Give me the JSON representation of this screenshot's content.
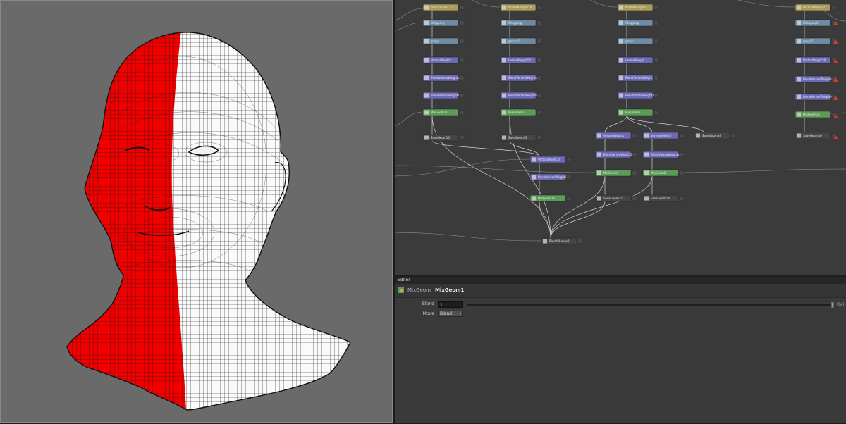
{
  "viewport": {
    "colors": {
      "background": "#6a6a6a",
      "mesh_base": "#fafafa",
      "mesh_selected": "#f20000",
      "wire": "#1a1a1a"
    }
  },
  "node_graph": {
    "colors": {
      "background": "#3b3b3b",
      "cache": "#a99b5b",
      "wrap": "#6f8aa3",
      "group": "#6f8aa3",
      "vertex": "#6c6ab8",
      "mesh": "#5d9c58",
      "output": "#464646",
      "wire": "#cfd3d6"
    },
    "nodes": [
      {
        "id": "n1",
        "label": "bscmDGrap127",
        "kind": "cache"
      },
      {
        "id": "n2",
        "label": "Wrapping",
        "kind": "wrap"
      },
      {
        "id": "n3",
        "label": "group",
        "kind": "group"
      },
      {
        "id": "n4",
        "label": "VertexWeight1",
        "kind": "vertex"
      },
      {
        "id": "n5",
        "label": "BlendVertexWeights2",
        "kind": "vertex"
      },
      {
        "id": "n6",
        "label": "BlendVertexWeight1",
        "kind": "vertex"
      },
      {
        "id": "n7",
        "label": "MixGeom11",
        "kind": "mesh"
      },
      {
        "id": "n8",
        "label": "SaveGeom16",
        "kind": "output"
      },
      {
        "id": "n9",
        "label": "bscmDGraphs10",
        "kind": "cache"
      },
      {
        "id": "n10",
        "label": "Wrapping",
        "kind": "wrap"
      },
      {
        "id": "n11",
        "label": "group10",
        "kind": "group"
      },
      {
        "id": "n12",
        "label": "VertexWeight10",
        "kind": "vertex"
      },
      {
        "id": "n13",
        "label": "BlendVertexWeights11",
        "kind": "vertex"
      },
      {
        "id": "n14",
        "label": "BlendVertexWeights12",
        "kind": "vertex"
      },
      {
        "id": "n15",
        "label": "MixGeom13",
        "kind": "mesh"
      },
      {
        "id": "n16",
        "label": "SaveGeom18",
        "kind": "output"
      },
      {
        "id": "n17",
        "label": "bscmDGraph8",
        "kind": "cache"
      },
      {
        "id": "n18",
        "label": "Wrapping",
        "kind": "wrap"
      },
      {
        "id": "n19",
        "label": "group",
        "kind": "group"
      },
      {
        "id": "n20",
        "label": "VertexWeight",
        "kind": "vertex"
      },
      {
        "id": "n21",
        "label": "BlendVertexWeight",
        "kind": "vertex"
      },
      {
        "id": "n22",
        "label": "BlendVertexWeight1",
        "kind": "vertex"
      },
      {
        "id": "n23",
        "label": "MixGeom1",
        "kind": "mesh"
      },
      {
        "id": "n24",
        "label": "VertexWeight1",
        "kind": "vertex"
      },
      {
        "id": "n25",
        "label": "VertexWeight2",
        "kind": "vertex"
      },
      {
        "id": "n26",
        "label": "SaveGeom19",
        "kind": "output"
      },
      {
        "id": "n27",
        "label": "BlendVertexWeight3",
        "kind": "vertex"
      },
      {
        "id": "n28",
        "label": "BlendVertexWeight4",
        "kind": "vertex"
      },
      {
        "id": "n29",
        "label": "MixGeom7",
        "kind": "mesh"
      },
      {
        "id": "n30",
        "label": "MixGeom2",
        "kind": "mesh"
      },
      {
        "id": "n31",
        "label": "SaveGeom17",
        "kind": "output"
      },
      {
        "id": "n32",
        "label": "SaveGeom18",
        "kind": "output"
      },
      {
        "id": "n33",
        "label": "VertexWeight14",
        "kind": "vertex"
      },
      {
        "id": "n34",
        "label": "BlendVertexWeight6",
        "kind": "vertex"
      },
      {
        "id": "n35",
        "label": "MixGeom16",
        "kind": "mesh"
      },
      {
        "id": "n36",
        "label": "bscmDGraph17",
        "kind": "cache"
      },
      {
        "id": "n37",
        "label": "Wrapping2",
        "kind": "wrap"
      },
      {
        "id": "n38",
        "label": "group11",
        "kind": "group"
      },
      {
        "id": "n39",
        "label": "VertexWeight18",
        "kind": "vertex"
      },
      {
        "id": "n40",
        "label": "BlendVertexWeight8",
        "kind": "vertex"
      },
      {
        "id": "n41",
        "label": "BlendVertexWeight9",
        "kind": "vertex"
      },
      {
        "id": "n42",
        "label": "MixGeom15",
        "kind": "mesh"
      },
      {
        "id": "n43",
        "label": "SaveGeom10",
        "kind": "output"
      },
      {
        "id": "n44",
        "label": "BlendShapes2",
        "kind": "output"
      }
    ]
  },
  "editor": {
    "tab_label": "Editor",
    "node_type": "MixGeom",
    "node_name": "MixGeom1",
    "params": [
      {
        "label": "Blend",
        "value": "1",
        "fx": "f(x)"
      },
      {
        "label": "Mode",
        "value": "Blend"
      }
    ],
    "mode_arrow": "▾"
  }
}
